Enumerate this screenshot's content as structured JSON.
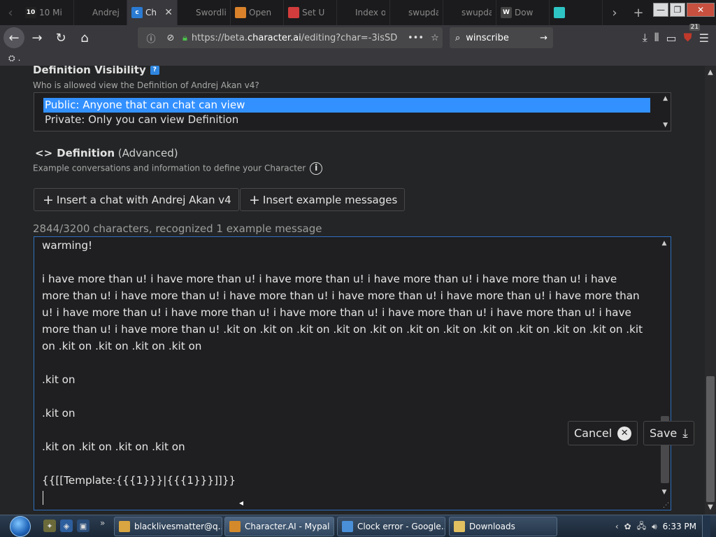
{
  "tabs": [
    {
      "label": "10 Mi",
      "favicon_text": "10",
      "favicon_color": "#222222"
    },
    {
      "label": "Andrej Ak",
      "favicon_text": "",
      "favicon_color": "#1b1b1d"
    },
    {
      "label": "Ch",
      "favicon_text": "c",
      "favicon_color": "#2b7bd3",
      "active": true
    },
    {
      "label": "Swordlink",
      "favicon_text": "",
      "favicon_color": "#1b1b1d"
    },
    {
      "label": "Open",
      "favicon_text": "",
      "favicon_color": "#d9822b"
    },
    {
      "label": "Set U",
      "favicon_text": "",
      "favicon_color": "#d23c3c"
    },
    {
      "label": "Index of /",
      "favicon_text": "",
      "favicon_color": "#1b1b1d"
    },
    {
      "label": "swupdate",
      "favicon_text": "",
      "favicon_color": "#1b1b1d"
    },
    {
      "label": "swupdate",
      "favicon_text": "",
      "favicon_color": "#1b1b1d"
    },
    {
      "label": "Dow",
      "favicon_text": "W",
      "favicon_color": "#444444"
    },
    {
      "label": "",
      "favicon_text": "",
      "favicon_color": "#2ec4c4"
    }
  ],
  "url": {
    "prefix": "https://beta.",
    "domain": "character.ai",
    "rest": "/editing?char=-3isSD"
  },
  "search": {
    "value": "winscribe"
  },
  "toolbar_badge": "21",
  "definition_visibility": {
    "title": "Definition Visibility",
    "description": "Who is allowed view the Definition of Andrej Akan v4?",
    "options": [
      "Public: Anyone that can chat can view",
      "Private: Only you can view Definition"
    ]
  },
  "definition": {
    "symbol": "<>",
    "name": "Definition",
    "qualifier": "(Advanced)",
    "description": "Example conversations and information to define your Character",
    "insert_chat_label": "Insert a chat with Andrej Akan v4",
    "insert_examples_label": "Insert example messages",
    "char_count": "2844/3200 characters, recognized 1 example message",
    "text": "warming!\n\ni have more than u! i have more than u! i have more than u! i have more than u! i have more than u! i have more than u! i have more than u! i have more than u! i have more than u! i have more than u! i have more than u! i have more than u! i have more than u! i have more than u! i have more than u! i have more than u! i have more than u! i have more than u! .kit on .kit on .kit on .kit on .kit on .kit on .kit on .kit on .kit on .kit on .kit on .kit on .kit on .kit on .kit on .kit on\n\n.kit on\n\n.kit on\n\n.kit on .kit on .kit on .kit on\n\n{{[[Template:{{{1}}}|{{{1}}}]]}}"
  },
  "actions": {
    "cancel_label": "Cancel",
    "save_label": "Save"
  },
  "taskbar": {
    "tasks": [
      {
        "label": "blacklivesmatter@q...",
        "icon_color": "#d9a641"
      },
      {
        "label": "Character.AI - Mypal",
        "icon_color": "#d48a2a",
        "active": true
      },
      {
        "label": "Clock error - Google...",
        "icon_color": "#4a90d9"
      },
      {
        "label": "Downloads",
        "icon_color": "#e3c160"
      }
    ],
    "time": "6:33 PM"
  }
}
